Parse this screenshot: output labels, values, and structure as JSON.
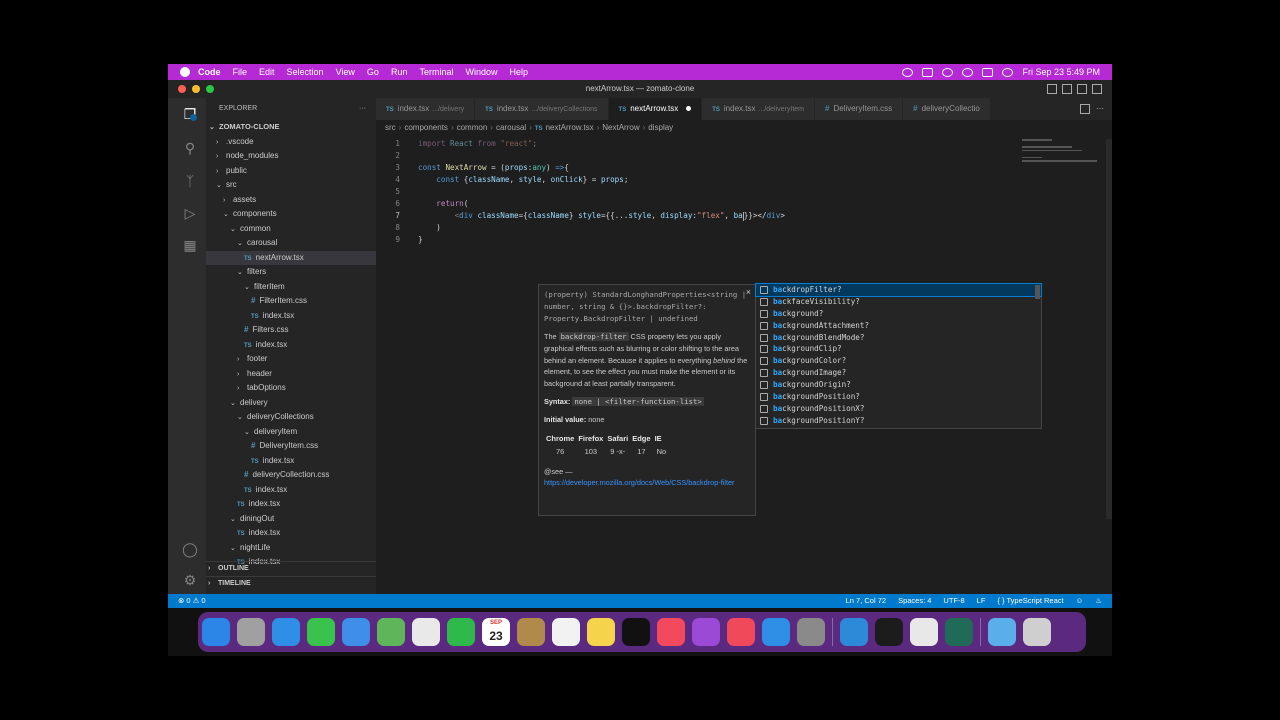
{
  "menubar": {
    "app": "Code",
    "items": [
      "File",
      "Edit",
      "Selection",
      "View",
      "Go",
      "Run",
      "Terminal",
      "Window",
      "Help"
    ],
    "clock": "Fri Sep 23  5:49 PM"
  },
  "window": {
    "title": "nextArrow.tsx — zomato-clone"
  },
  "sidebar": {
    "header": "EXPLORER",
    "more": "···",
    "root": "ZOMATO-CLONE",
    "tree": [
      {
        "label": ".vscode",
        "depth": 1,
        "kind": "folder",
        "open": false
      },
      {
        "label": "node_modules",
        "depth": 1,
        "kind": "folder",
        "open": false
      },
      {
        "label": "public",
        "depth": 1,
        "kind": "folder",
        "open": false
      },
      {
        "label": "src",
        "depth": 1,
        "kind": "folder",
        "open": true
      },
      {
        "label": "assets",
        "depth": 2,
        "kind": "folder",
        "open": false
      },
      {
        "label": "components",
        "depth": 2,
        "kind": "folder",
        "open": true
      },
      {
        "label": "common",
        "depth": 3,
        "kind": "folder",
        "open": true
      },
      {
        "label": "carousal",
        "depth": 4,
        "kind": "folder",
        "open": true
      },
      {
        "label": "nextArrow.tsx",
        "depth": 5,
        "kind": "ts",
        "selected": true
      },
      {
        "label": "filters",
        "depth": 4,
        "kind": "folder",
        "open": true
      },
      {
        "label": "filterItem",
        "depth": 5,
        "kind": "folder",
        "open": true
      },
      {
        "label": "FilterItem.css",
        "depth": 6,
        "kind": "css"
      },
      {
        "label": "index.tsx",
        "depth": 6,
        "kind": "ts"
      },
      {
        "label": "Filters.css",
        "depth": 5,
        "kind": "css"
      },
      {
        "label": "index.tsx",
        "depth": 5,
        "kind": "ts"
      },
      {
        "label": "footer",
        "depth": 4,
        "kind": "folder",
        "open": false
      },
      {
        "label": "header",
        "depth": 4,
        "kind": "folder",
        "open": false
      },
      {
        "label": "tabOptions",
        "depth": 4,
        "kind": "folder",
        "open": false
      },
      {
        "label": "delivery",
        "depth": 3,
        "kind": "folder",
        "open": true
      },
      {
        "label": "deliveryCollections",
        "depth": 4,
        "kind": "folder",
        "open": true
      },
      {
        "label": "deliveryItem",
        "depth": 5,
        "kind": "folder",
        "open": true
      },
      {
        "label": "DeliveryItem.css",
        "depth": 6,
        "kind": "css"
      },
      {
        "label": "index.tsx",
        "depth": 6,
        "kind": "ts"
      },
      {
        "label": "deliveryCollection.css",
        "depth": 5,
        "kind": "css"
      },
      {
        "label": "index.tsx",
        "depth": 5,
        "kind": "ts"
      },
      {
        "label": "index.tsx",
        "depth": 4,
        "kind": "ts"
      },
      {
        "label": "diningOut",
        "depth": 3,
        "kind": "folder",
        "open": true
      },
      {
        "label": "index.tsx",
        "depth": 4,
        "kind": "ts"
      },
      {
        "label": "nightLife",
        "depth": 3,
        "kind": "folder",
        "open": true
      },
      {
        "label": "index.tsx",
        "depth": 4,
        "kind": "ts"
      }
    ],
    "outline": "OUTLINE",
    "timeline": "TIMELINE"
  },
  "tabs": [
    {
      "name": "index.tsx",
      "desc": ".../delivery",
      "kind": "ts"
    },
    {
      "name": "index.tsx",
      "desc": ".../deliveryCollections",
      "kind": "ts"
    },
    {
      "name": "nextArrow.tsx",
      "desc": "",
      "kind": "ts",
      "active": true,
      "dirty": true
    },
    {
      "name": "index.tsx",
      "desc": ".../deliveryItem",
      "kind": "ts"
    },
    {
      "name": "DeliveryItem.css",
      "desc": "",
      "kind": "css"
    },
    {
      "name": "deliveryCollectio",
      "desc": "",
      "kind": "css"
    }
  ],
  "breadcrumb": [
    "src",
    "components",
    "common",
    "carousal",
    "nextArrow.tsx",
    "NextArrow",
    "display"
  ],
  "code": {
    "line_numbers": [
      "1",
      "2",
      "3",
      "4",
      "5",
      "6",
      "7",
      "8",
      "9"
    ],
    "current_line": "7"
  },
  "hover": {
    "signature": "(property) StandardLonghandProperties<string | number, string & {}>.backdropFilter?: Property.BackdropFilter | undefined",
    "desc_prefix": "The",
    "desc_code": "backdrop-filter",
    "desc_mid": "CSS property lets you apply graphical effects such as blurring or color shifting to the area behind an element. Because it applies to everything",
    "desc_em": "behind",
    "desc_end": "the element, to see the effect you must make the element or its background at least partially transparent.",
    "syntax_label": "Syntax:",
    "syntax_value": "none | <filter-function-list>",
    "initial_label": "Initial value:",
    "initial_value": "none",
    "compat_headers": [
      "Chrome",
      "Firefox",
      "Safari",
      "Edge",
      "IE"
    ],
    "compat_values": [
      "76",
      "103",
      "9 -x-",
      "17",
      "No"
    ],
    "see_label": "@see —",
    "link": "https://developer.mozilla.org/docs/Web/CSS/backdrop-filter",
    "close": "×"
  },
  "suggestions": [
    {
      "match": "ba",
      "rest": "ckdropFilter?",
      "selected": true
    },
    {
      "match": "ba",
      "rest": "ckfaceVisibility?"
    },
    {
      "match": "ba",
      "rest": "ckground?"
    },
    {
      "match": "ba",
      "rest": "ckgroundAttachment?"
    },
    {
      "match": "ba",
      "rest": "ckgroundBlendMode?"
    },
    {
      "match": "ba",
      "rest": "ckgroundClip?"
    },
    {
      "match": "ba",
      "rest": "ckgroundColor?"
    },
    {
      "match": "ba",
      "rest": "ckgroundImage?"
    },
    {
      "match": "ba",
      "rest": "ckgroundOrigin?"
    },
    {
      "match": "ba",
      "rest": "ckgroundPosition?"
    },
    {
      "match": "ba",
      "rest": "ckgroundPositionX?"
    },
    {
      "match": "ba",
      "rest": "ckgroundPositionY?"
    }
  ],
  "status": {
    "problems": "⊗ 0 ⚠ 0",
    "position": "Ln 7, Col 72",
    "spaces": "Spaces: 4",
    "encoding": "UTF-8",
    "eol": "LF",
    "language": "{ } TypeScript React"
  },
  "dock": {
    "calendar_month": "SEP",
    "calendar_day": "23",
    "apps": [
      {
        "name": "finder-icon",
        "color": "#2b86e8"
      },
      {
        "name": "launchpad-icon",
        "color": "#a0a0a0"
      },
      {
        "name": "safari-icon",
        "color": "#2f8ee6"
      },
      {
        "name": "messages-icon",
        "color": "#39c24c"
      },
      {
        "name": "mail-icon",
        "color": "#3f8fe8"
      },
      {
        "name": "maps-icon",
        "color": "#5fb65a"
      },
      {
        "name": "photos-icon",
        "color": "#e9e9e9"
      },
      {
        "name": "facetime-icon",
        "color": "#2fb94a"
      },
      {
        "name": "calendar-icon",
        "color": "#ffffff"
      },
      {
        "name": "notes-brown-icon",
        "color": "#b08a4a"
      },
      {
        "name": "reminders-icon",
        "color": "#f2f2f2"
      },
      {
        "name": "notes-icon",
        "color": "#f5d34a"
      },
      {
        "name": "appletv-icon",
        "color": "#111111"
      },
      {
        "name": "music-icon",
        "color": "#f24a5c"
      },
      {
        "name": "podcasts-icon",
        "color": "#9a4ad6"
      },
      {
        "name": "news-icon",
        "color": "#f04a5a"
      },
      {
        "name": "appstore-icon",
        "color": "#2f8ee6"
      },
      {
        "name": "settings-icon",
        "color": "#8a8a8a"
      },
      {
        "name": "vscode-icon",
        "color": "#2c8ad9"
      },
      {
        "name": "terminal-icon",
        "color": "#1c1c1c"
      },
      {
        "name": "chrome-icon",
        "color": "#e8e8e8"
      },
      {
        "name": "gitkraken-icon",
        "color": "#1f6b57"
      },
      {
        "name": "folder-icon",
        "color": "#5aaeea"
      },
      {
        "name": "trash-icon",
        "color": "#cfcfcf"
      }
    ]
  },
  "colors": {
    "menubar": "#b62ad6",
    "statusbar": "#007acc",
    "dock": "#5b2a80"
  }
}
